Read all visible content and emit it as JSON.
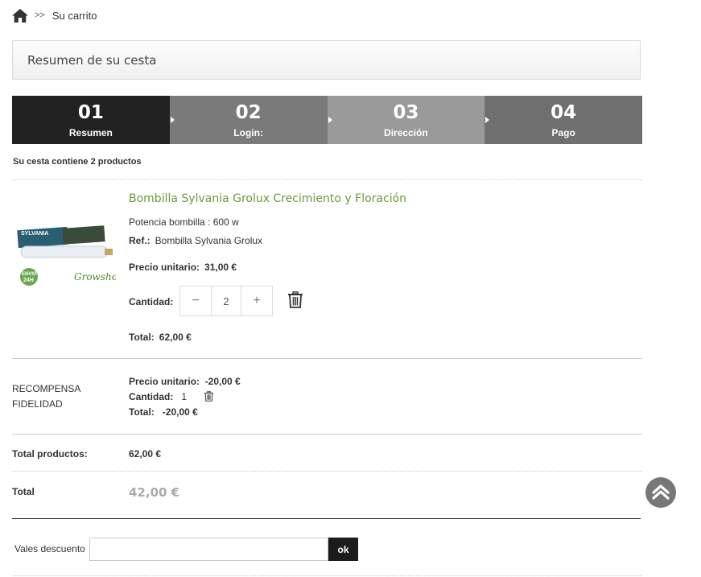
{
  "breadcrumb": {
    "separator": ">>",
    "current": "Su carrito"
  },
  "header": {
    "title": "Resumen de su cesta"
  },
  "steps": [
    {
      "number": "01",
      "label": "Resumen",
      "color": "#222222"
    },
    {
      "number": "02",
      "label": "Login:",
      "color": "#7a7a7a"
    },
    {
      "number": "03",
      "label": "Dirección",
      "color": "#9a9a9a"
    },
    {
      "number": "04",
      "label": "Pago",
      "color": "#6f6f6f"
    }
  ],
  "cart_summary": "Su cesta contiene 2 productos",
  "product": {
    "name": "Bombilla Sylvania Grolux Crecimiento y Floración",
    "attribute": "Potencia bombilla : 600 w",
    "ref_label": "Ref.:",
    "ref_value": "Bombilla Sylvania Grolux",
    "unit_price_label": "Precio unitario:",
    "unit_price": "31,00 €",
    "quantity_label": "Cantidad:",
    "quantity": "2",
    "minus": "−",
    "plus": "+",
    "total_label": "Total:",
    "total": "62,00 €",
    "image_badge": "ENVIO 24H",
    "image_logo": "Growshop",
    "image_brand": "SYLVANIA"
  },
  "reward": {
    "name": "Recompensa fidelidad",
    "unit_price_label": "Precio unitario:",
    "unit_price": "-20,00 €",
    "quantity_label": "Cantidad:",
    "quantity": "1",
    "total_label": "Total:",
    "total": "-20,00 €"
  },
  "totals": {
    "products_label": "Total productos:",
    "products_value": "62,00 €",
    "total_label": "Total",
    "total_value": "42,00 €"
  },
  "voucher": {
    "label": "Vales descuento",
    "value": "",
    "placeholder": "",
    "button": "ok"
  },
  "colors": {
    "accent_green": "#6a9a3a",
    "dark": "#1c1c1c"
  }
}
